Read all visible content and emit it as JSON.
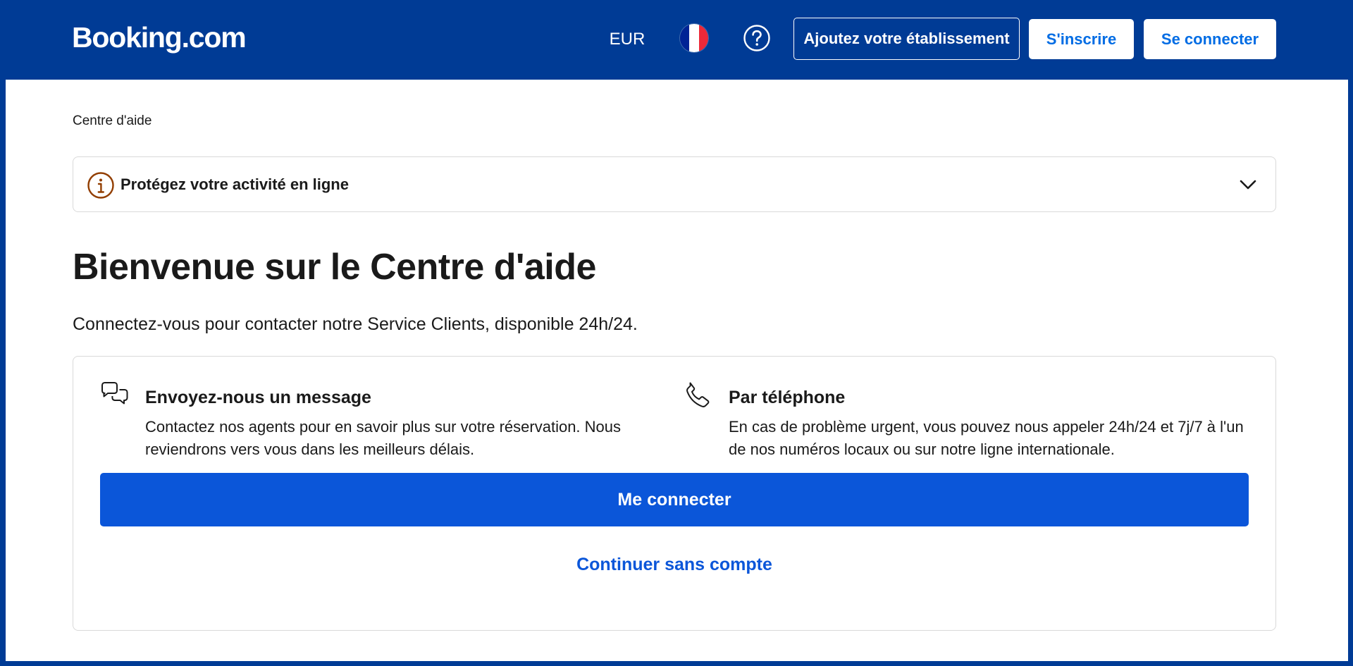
{
  "header": {
    "logo": "Booking.com",
    "currency": "EUR",
    "language_flag": {
      "icon": "france-flag-icon",
      "colors": [
        "#002395",
        "#ffffff",
        "#ed2939"
      ]
    },
    "help_icon": "question-circle-icon",
    "list_property_label": "Ajoutez votre établissement",
    "register_label": "S'inscrire",
    "signin_label": "Se connecter"
  },
  "breadcrumb": "Centre d'aide",
  "alert": {
    "icon": "info-circle-icon",
    "text": "Protégez votre activité en ligne",
    "toggle_icon": "chevron-down-icon"
  },
  "page": {
    "title": "Bienvenue sur le Centre d'aide",
    "subtitle": "Connectez-vous pour contacter notre Service Clients, disponible 24h/24."
  },
  "contact": {
    "options": [
      {
        "icon": "chat-bubbles-icon",
        "title": "Envoyez-nous un message",
        "description": "Contactez nos agents pour en savoir plus sur votre réservation. Nous reviendrons vers vous dans les meilleurs délais."
      },
      {
        "icon": "phone-icon",
        "title": "Par téléphone",
        "description": "En cas de problème urgent, vous pouvez nous appeler 24h/24 et 7j/7 à l'un de nos numéros locaux ou sur notre ligne internationale."
      }
    ],
    "primary_button": "Me connecter",
    "secondary_link": "Continuer sans compte"
  },
  "colors": {
    "brand_blue": "#003b95",
    "action_blue": "#0b56d9",
    "link_blue": "#006ce4",
    "alert_icon": "#923e01"
  }
}
